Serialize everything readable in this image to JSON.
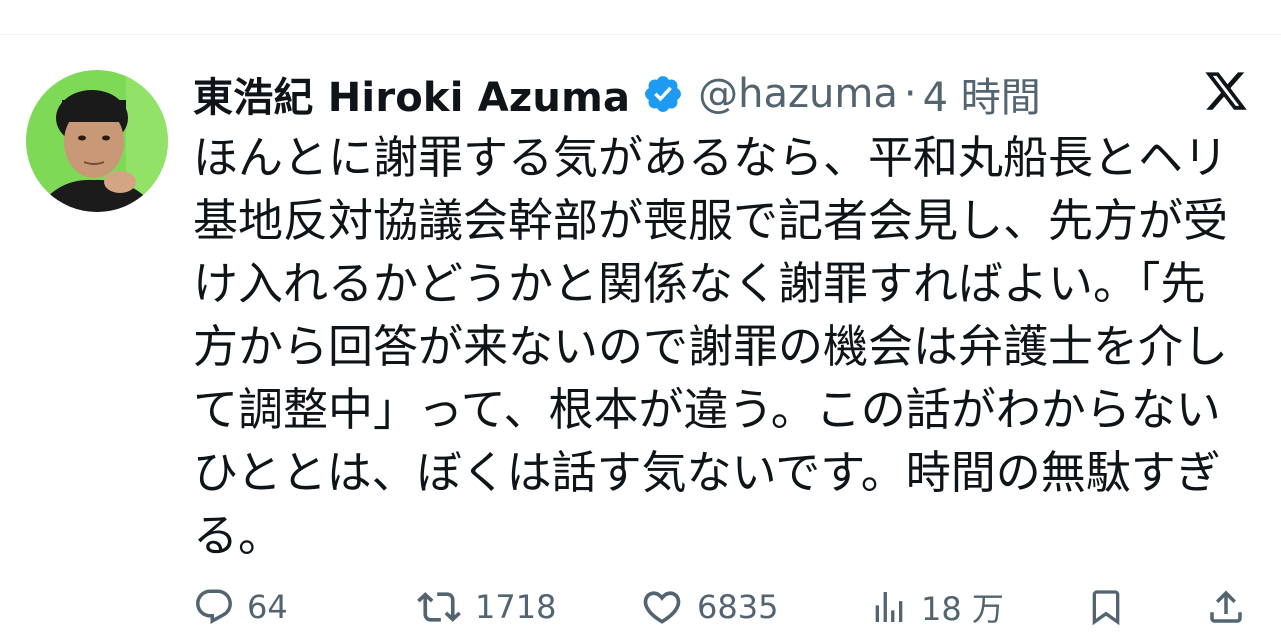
{
  "tweet": {
    "display_name": "東浩紀 Hiroki Azuma",
    "handle": "@hazuma",
    "separator": "·",
    "time": "4 時間",
    "verified": true,
    "text_lines": [
      "ほんとに謝罪する気があるなら、平和丸船長とヘリ",
      "基地反対協議会幹部が喪服で記者会見し、先方が受",
      "け入れるかどうかと関係なく謝罪すればよい。「先",
      "方から回答が来ないので謝罪の機会は弁護士を介し",
      "て調整中」って、根本が違う。この話がわからない",
      "ひととは、ぼくは話す気ないです。時間の無駄すぎ",
      "る。"
    ]
  },
  "actions": {
    "reply": {
      "icon": "reply-icon",
      "count": "64"
    },
    "retweet": {
      "icon": "retweet-icon",
      "count": "1718"
    },
    "like": {
      "icon": "heart-icon",
      "count": "6835"
    },
    "views": {
      "icon": "bar-chart-icon",
      "count": "18 万"
    },
    "bookmark": {
      "icon": "bookmark-icon"
    },
    "share": {
      "icon": "share-icon"
    }
  },
  "colors": {
    "text": "#0f1419",
    "secondary": "#536471",
    "verified": "#1d9bf0",
    "avatar_background": "#7ed957"
  },
  "icons": {
    "platform_logo": "x-logo-icon",
    "verified_badge": "verified-badge-icon"
  }
}
